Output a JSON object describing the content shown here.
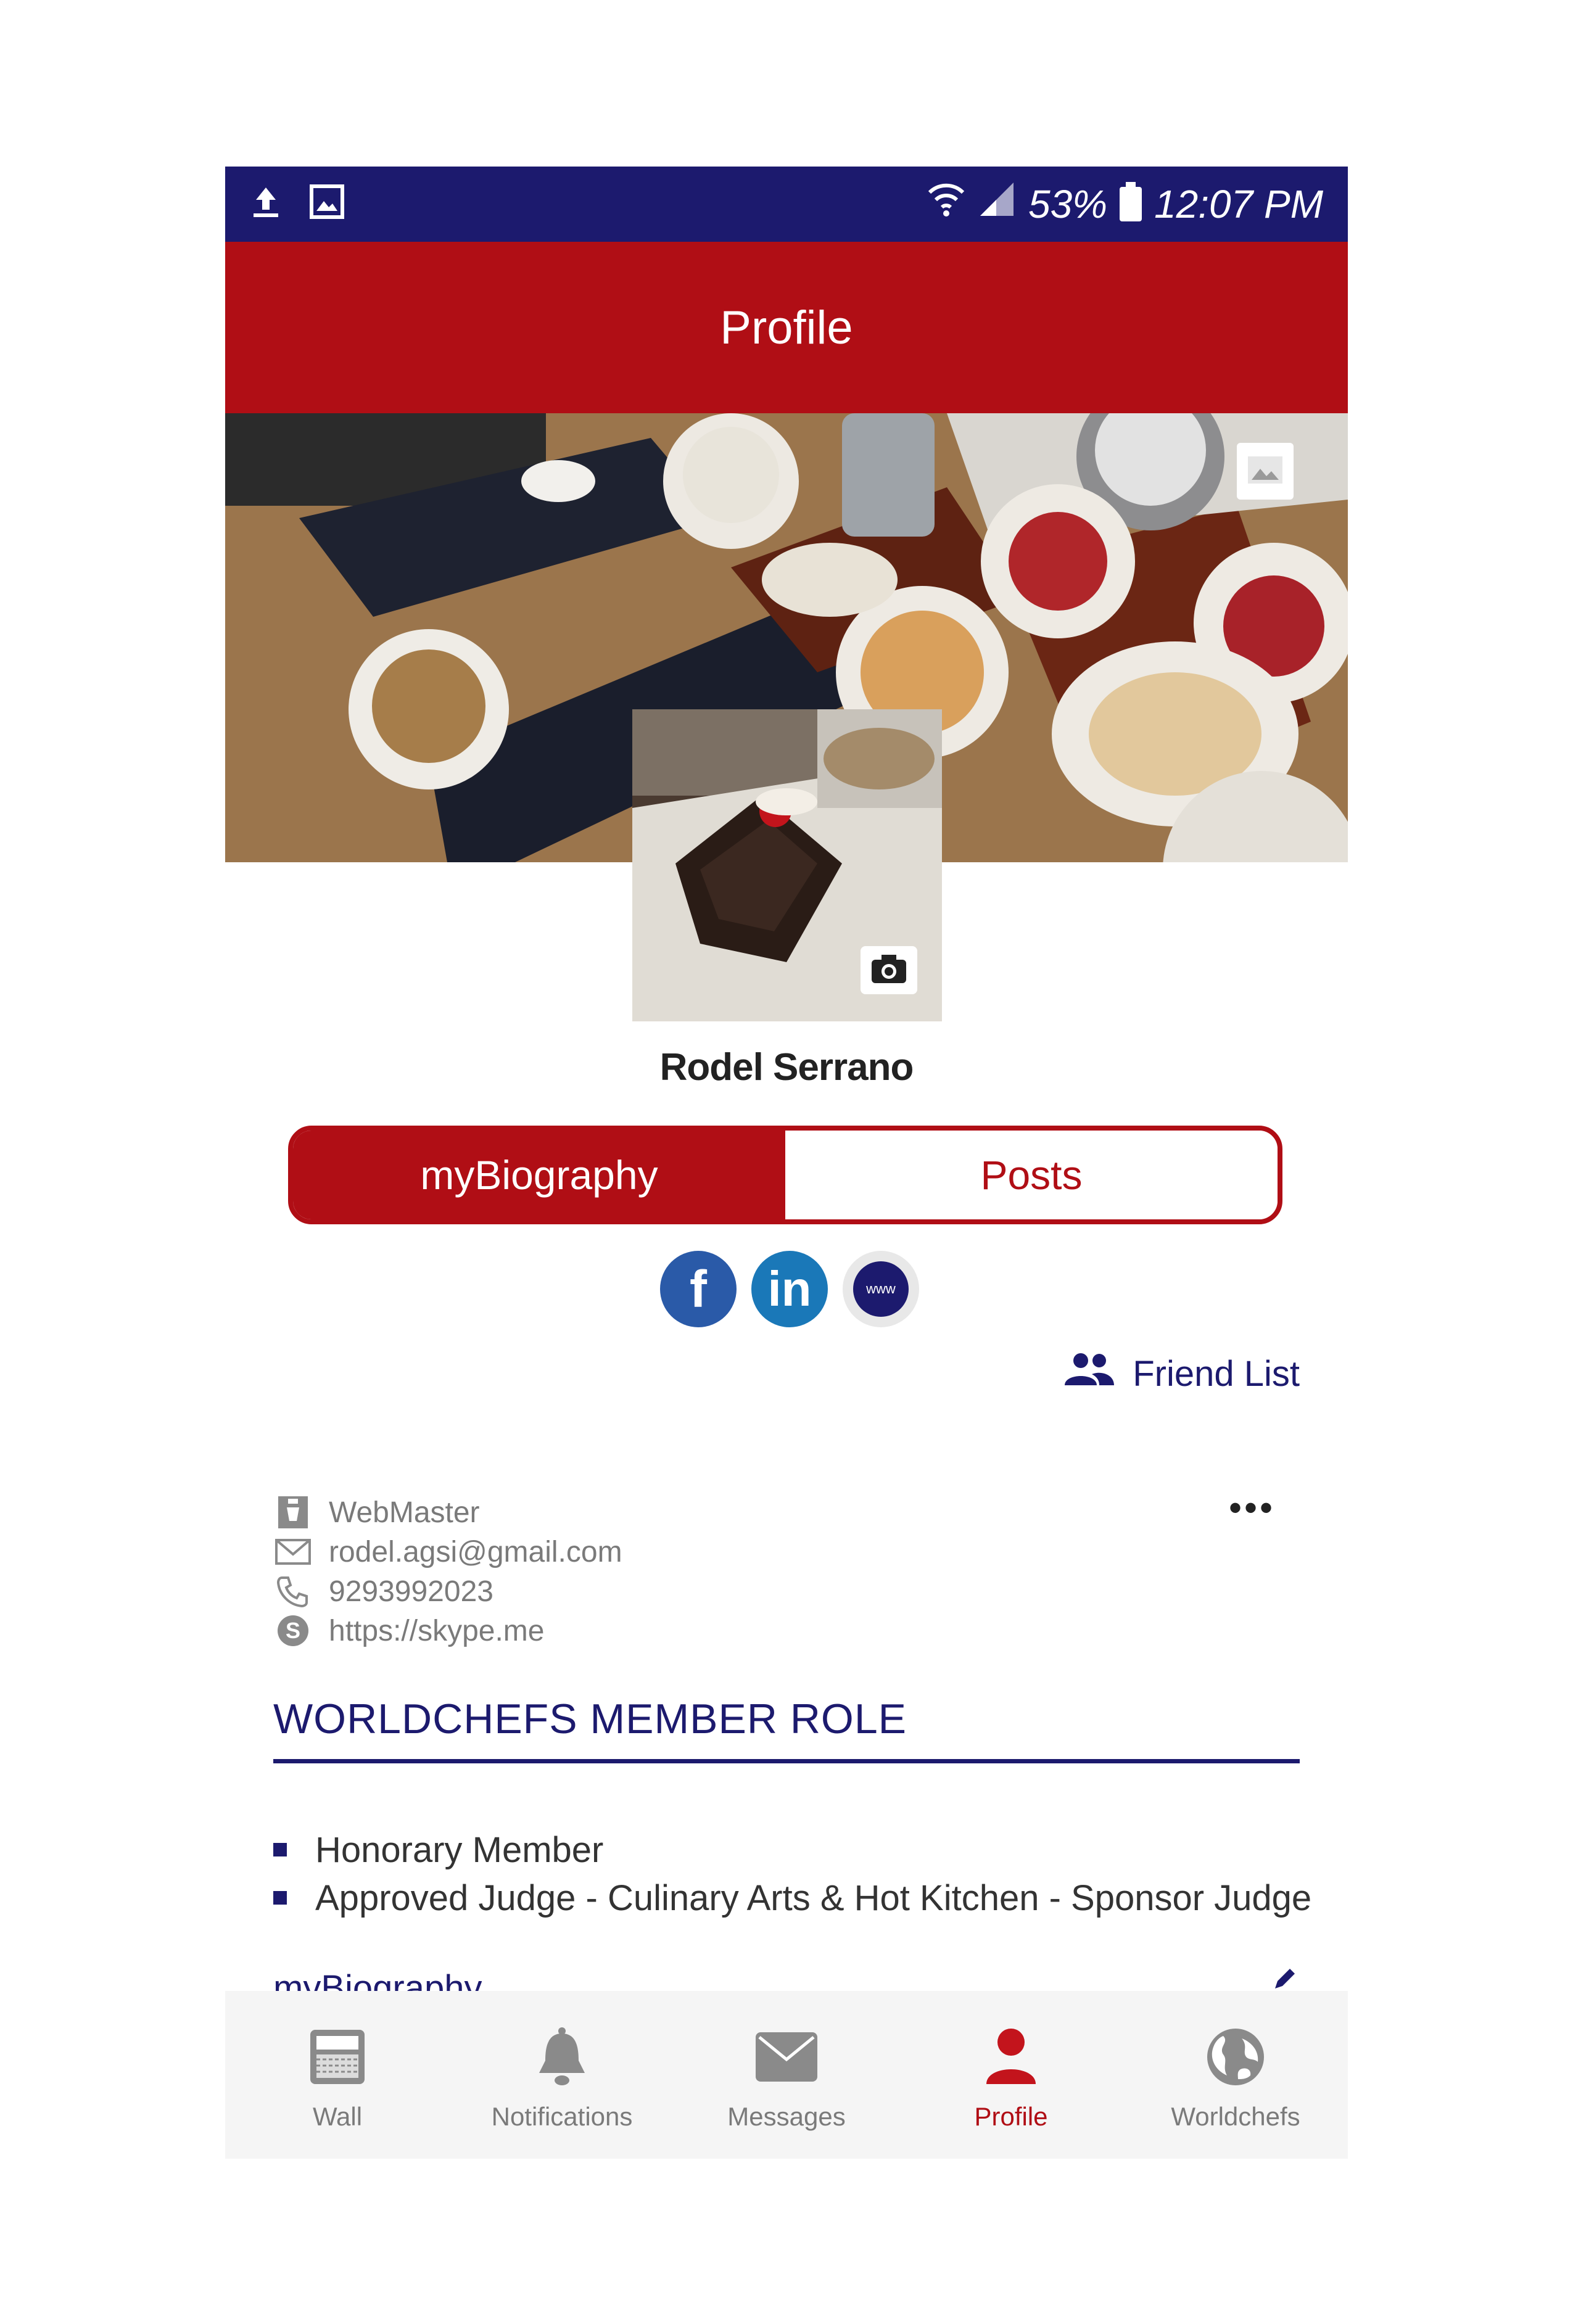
{
  "status_bar": {
    "battery": "53%",
    "time": "12:07 PM"
  },
  "app_bar": {
    "title": "Profile"
  },
  "profile": {
    "name": "Rodel Serrano"
  },
  "tabs": [
    {
      "label": "myBiography",
      "active": true
    },
    {
      "label": "Posts",
      "active": false
    }
  ],
  "social": {
    "facebook": "f",
    "linkedin": "in",
    "website": "www"
  },
  "friend_list_label": "Friend List",
  "contact": {
    "role": "WebMaster",
    "email": "rodel.agsi@gmail.com",
    "phone": "9293992023",
    "skype": "https://skype.me"
  },
  "role_section": {
    "heading": "WORLDCHEFS MEMBER ROLE",
    "items": [
      "Honorary Member",
      "Approved Judge - Culinary Arts & Hot Kitchen - Sponsor Judge"
    ]
  },
  "biography_heading": "myBiography",
  "bottom_nav": [
    {
      "label": "Wall",
      "icon": "wall-icon",
      "active": false
    },
    {
      "label": "Notifications",
      "icon": "bell-icon",
      "active": false
    },
    {
      "label": "Messages",
      "icon": "envelope-icon",
      "active": false
    },
    {
      "label": "Profile",
      "icon": "person-icon",
      "active": true
    },
    {
      "label": "Worldchefs",
      "icon": "globe-icon",
      "active": false
    }
  ],
  "colors": {
    "navy": "#1c1a6e",
    "brand_red": "#b00e15",
    "gray_text": "#7a7a7a"
  }
}
